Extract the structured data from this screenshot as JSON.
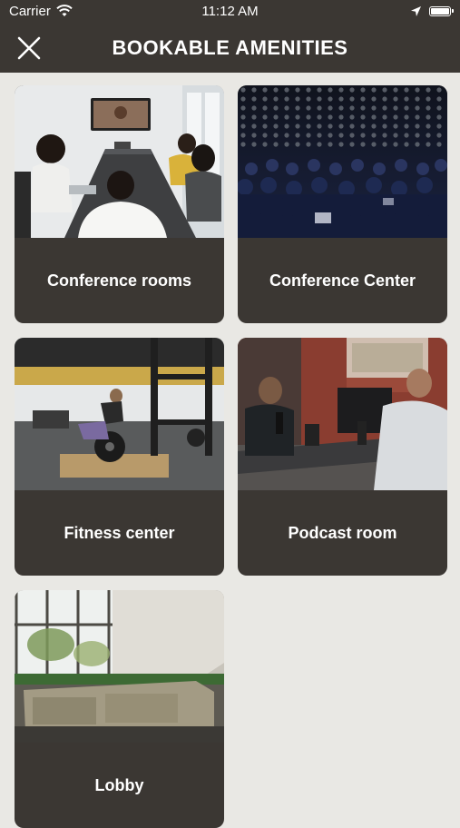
{
  "status_bar": {
    "carrier": "Carrier",
    "time": "11:12 AM",
    "icons": [
      "wifi-icon",
      "location-arrow-icon",
      "battery-icon"
    ]
  },
  "header": {
    "title": "BOOKABLE AMENITIES",
    "close_icon": "close-icon",
    "background_color": "#3b3733"
  },
  "amenities": [
    {
      "label": "Conference rooms",
      "photo": "conference-room-photo"
    },
    {
      "label": "Conference Center",
      "photo": "audience-photo"
    },
    {
      "label": "Fitness center",
      "photo": "gym-photo"
    },
    {
      "label": "Podcast room",
      "photo": "podcast-photo"
    },
    {
      "label": "Lobby",
      "photo": "lobby-photo"
    }
  ],
  "colors": {
    "background": "#e9e8e4",
    "card": "#3b3733",
    "text": "#ffffff"
  }
}
